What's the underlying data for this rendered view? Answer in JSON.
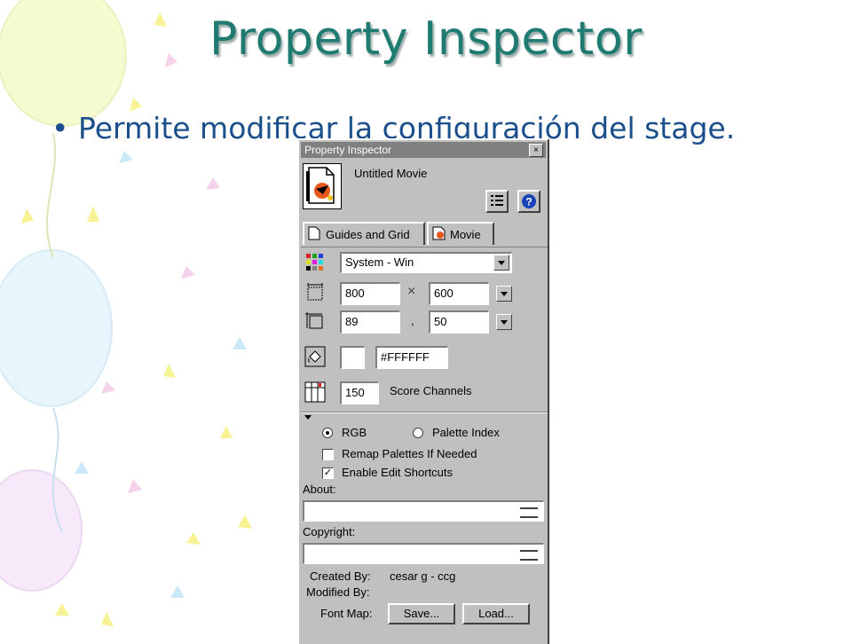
{
  "slide": {
    "title": "Property Inspector",
    "bullet": "Permite modificar la configuración del stage."
  },
  "inspector": {
    "window_title": "Property Inspector",
    "close_glyph": "×",
    "movie_name": "Untitled Movie",
    "tabs": [
      {
        "label": "Guides and Grid",
        "icon": "page-icon"
      },
      {
        "label": "Movie",
        "icon": "movie-icon"
      }
    ],
    "palette": {
      "value": "System - Win",
      "icon": "palette-grid-icon"
    },
    "stage_size": {
      "width": "800",
      "separator": "×",
      "height": "600",
      "icon": "stage-size-icon"
    },
    "stage_location": {
      "left": "89",
      "separator": ",",
      "top": "50",
      "icon": "stage-location-icon"
    },
    "stage_color": {
      "value": "#FFFFFF",
      "swatch": "#FFFFFF",
      "icon": "paint-bucket-icon"
    },
    "score_channels": {
      "value": "150",
      "label": "Score Channels",
      "icon": "score-channels-icon"
    },
    "color_mode": {
      "rgb_label": "RGB",
      "palette_index_label": "Palette Index",
      "selected": "RGB"
    },
    "remap_palettes": {
      "label": "Remap Palettes If Needed",
      "checked": false
    },
    "edit_shortcuts": {
      "label": "Enable Edit Shortcuts",
      "checked": true
    },
    "about_label": "About:",
    "about_value": "",
    "copyright_label": "Copyright:",
    "copyright_value": "",
    "created_by_label": "Created By:",
    "created_by_value": "cesar g - ccg",
    "modified_by_label": "Modified By:",
    "modified_by_value": "",
    "font_map_label": "Font Map:",
    "save_label": "Save...",
    "load_label": "Load..."
  }
}
